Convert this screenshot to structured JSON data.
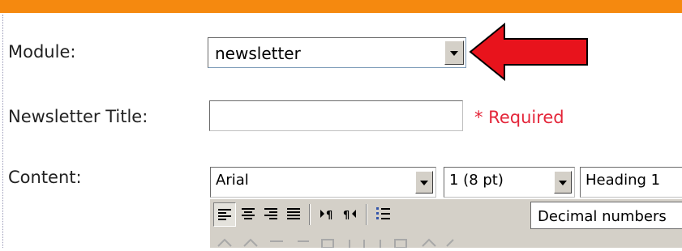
{
  "form": {
    "module_label": "Module:",
    "module_value": "newsletter",
    "title_label": "Newsletter Title:",
    "title_value": "",
    "required_text": "* Required",
    "content_label": "Content:"
  },
  "editor": {
    "font_name": "Arial",
    "font_size": "1 (8 pt)",
    "block_format": "Heading 1",
    "list_style": "Decimal numbers"
  },
  "colors": {
    "top_bar": "#f5890f",
    "arrow": "#e8131c",
    "required": "#e4263a",
    "toolbar": "#d4d0c8"
  },
  "icons": [
    "align-left-icon",
    "align-center-icon",
    "align-right-icon",
    "justify-icon",
    "ltr-icon",
    "rtl-icon",
    "ordered-list-icon",
    "dropdown-arrow-icon"
  ]
}
